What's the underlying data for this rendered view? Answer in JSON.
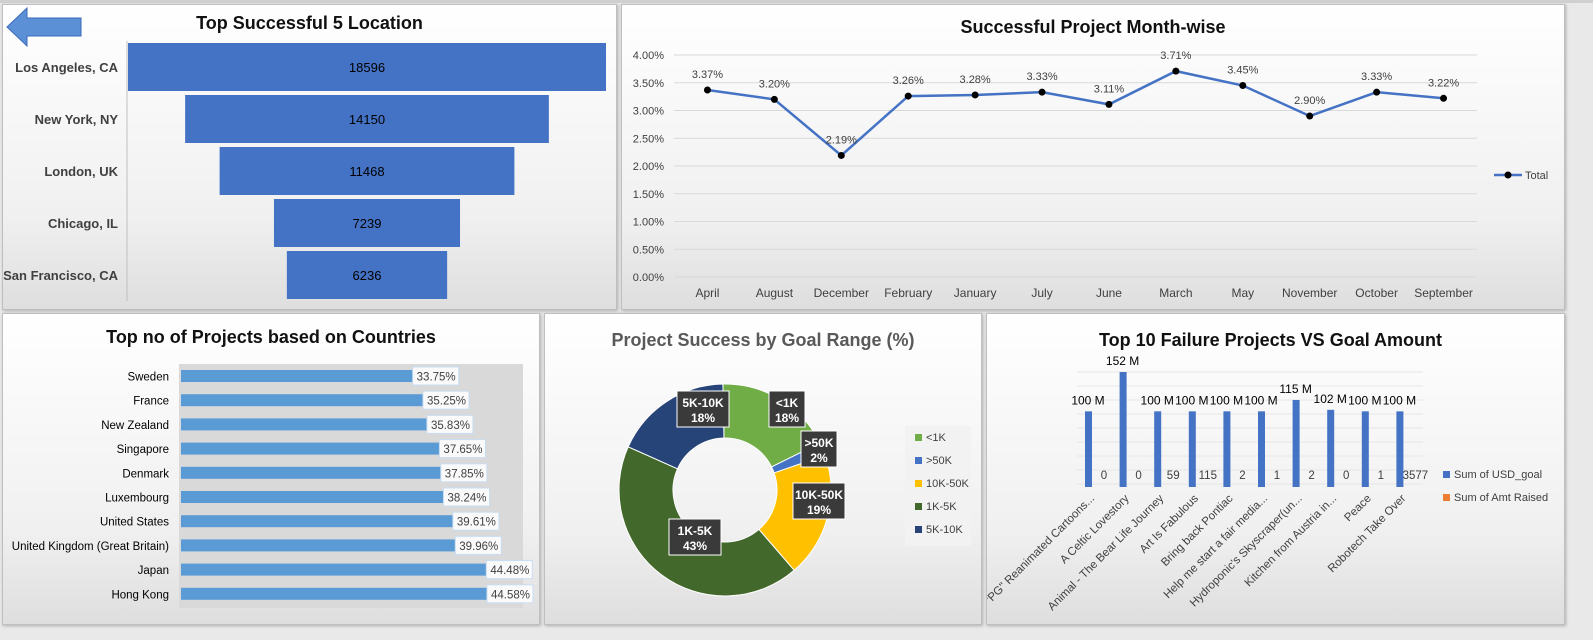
{
  "panels": {
    "location": {
      "title": "Top Successful 5 Location",
      "chart_data": {
        "type": "bar",
        "orientation": "horizontal-funnel",
        "title": "Top Successful 5 Location",
        "categories": [
          "Los Angeles, CA",
          "New York, NY",
          "London, UK",
          "Chicago, IL",
          "San Francisco, CA"
        ],
        "values": [
          18596,
          14150,
          11468,
          7239,
          6236
        ],
        "bar_color": "#4472C4"
      }
    },
    "monthly": {
      "title": "Successful Project Month-wise",
      "chart_data": {
        "type": "line",
        "title": "Successful Project Month-wise",
        "categories": [
          "April",
          "August",
          "December",
          "February",
          "January",
          "July",
          "June",
          "March",
          "May",
          "November",
          "October",
          "September"
        ],
        "series": [
          {
            "name": "Total",
            "values": [
              3.37,
              3.2,
              2.19,
              3.26,
              3.28,
              3.33,
              3.11,
              3.71,
              3.45,
              2.9,
              3.33,
              3.22
            ]
          }
        ],
        "data_labels": [
          "3.37%",
          "3.20%",
          "2.19%",
          "3.26%",
          "3.28%",
          "3.33%",
          "3.11%",
          "3.71%",
          "3.45%",
          "2.90%",
          "3.33%",
          "3.22%"
        ],
        "ylim": [
          0,
          4.0
        ],
        "yticks": [
          "0.00%",
          "0.50%",
          "1.00%",
          "1.50%",
          "2.00%",
          "2.50%",
          "3.00%",
          "3.50%",
          "4.00%"
        ],
        "grid": true,
        "legend": "right",
        "line_color": "#4472C4"
      }
    },
    "countries": {
      "title": "Top no of Projects based on Countries",
      "chart_data": {
        "type": "bar",
        "orientation": "horizontal",
        "title": "Top no of Projects based on Countries",
        "categories": [
          "Sweden",
          "France",
          "New Zealand",
          "Singapore",
          "Denmark",
          "Luxembourg",
          "United States",
          "United Kingdom (Great Britain)",
          "Japan",
          "Hong Kong"
        ],
        "values": [
          33.75,
          35.25,
          35.83,
          37.65,
          37.85,
          38.24,
          39.61,
          39.96,
          44.48,
          44.58
        ],
        "data_labels": [
          "33.75%",
          "35.25%",
          "35.83%",
          "37.65%",
          "37.85%",
          "38.24%",
          "39.61%",
          "39.96%",
          "44.48%",
          "44.58%"
        ],
        "bar_color": "#5B9BD5"
      }
    },
    "goal_range": {
      "title": "Project Success by Goal Range (%)",
      "chart_data": {
        "type": "pie",
        "variant": "donut",
        "title": "Project Success by Goal Range (%)",
        "labels": [
          "<1K",
          ">50K",
          "10K-50K",
          "1K-5K",
          "5K-10K"
        ],
        "values": [
          18,
          2,
          19,
          43,
          18
        ],
        "data_labels": [
          "18%",
          "2%",
          "19%",
          "43%",
          "18%"
        ],
        "colors": [
          "#70AD47",
          "#4472C4",
          "#FFC000",
          "#43682B",
          "#264478"
        ],
        "legend": "right"
      }
    },
    "failure": {
      "title": "Top 10 Failure Projects VS Goal Amount",
      "chart_data": {
        "type": "bar",
        "title": "Top 10 Failure Projects VS Goal Amount",
        "categories": [
          "\"PG\" Reanimated Cartoons...",
          "A Celtic Lovestory",
          "Animal - The Bear Life Journey",
          "Art Is Fabulous",
          "Bring back Pontiac",
          "Help me start a fair media...",
          "Hydroponic's Skyscraper(un...",
          "Kitchen from Austria in...",
          "Peace",
          "Robotech Take Over"
        ],
        "series": [
          {
            "name": "Sum of USD_goal",
            "values": [
              100,
              152,
              100,
              100,
              100,
              100,
              115,
              102,
              100,
              100
            ],
            "labels": [
              "100 M",
              "152 M",
              "100 M",
              "100 M",
              "100 M",
              "100 M",
              "115 M",
              "102 M",
              "100 M",
              "100 M"
            ],
            "color": "#4472C4"
          },
          {
            "name": "Sum of Amt Raised",
            "values": [
              0,
              0,
              59,
              115,
              2,
              1,
              2,
              0,
              1,
              3577
            ],
            "labels": [
              "0",
              "0",
              "59",
              "115",
              "2",
              "1",
              "2",
              "0",
              "1",
              "3577"
            ],
            "color": "#ED7D31"
          }
        ],
        "legend": "right"
      }
    }
  },
  "nav": {
    "back_icon": "back-arrow-icon"
  }
}
